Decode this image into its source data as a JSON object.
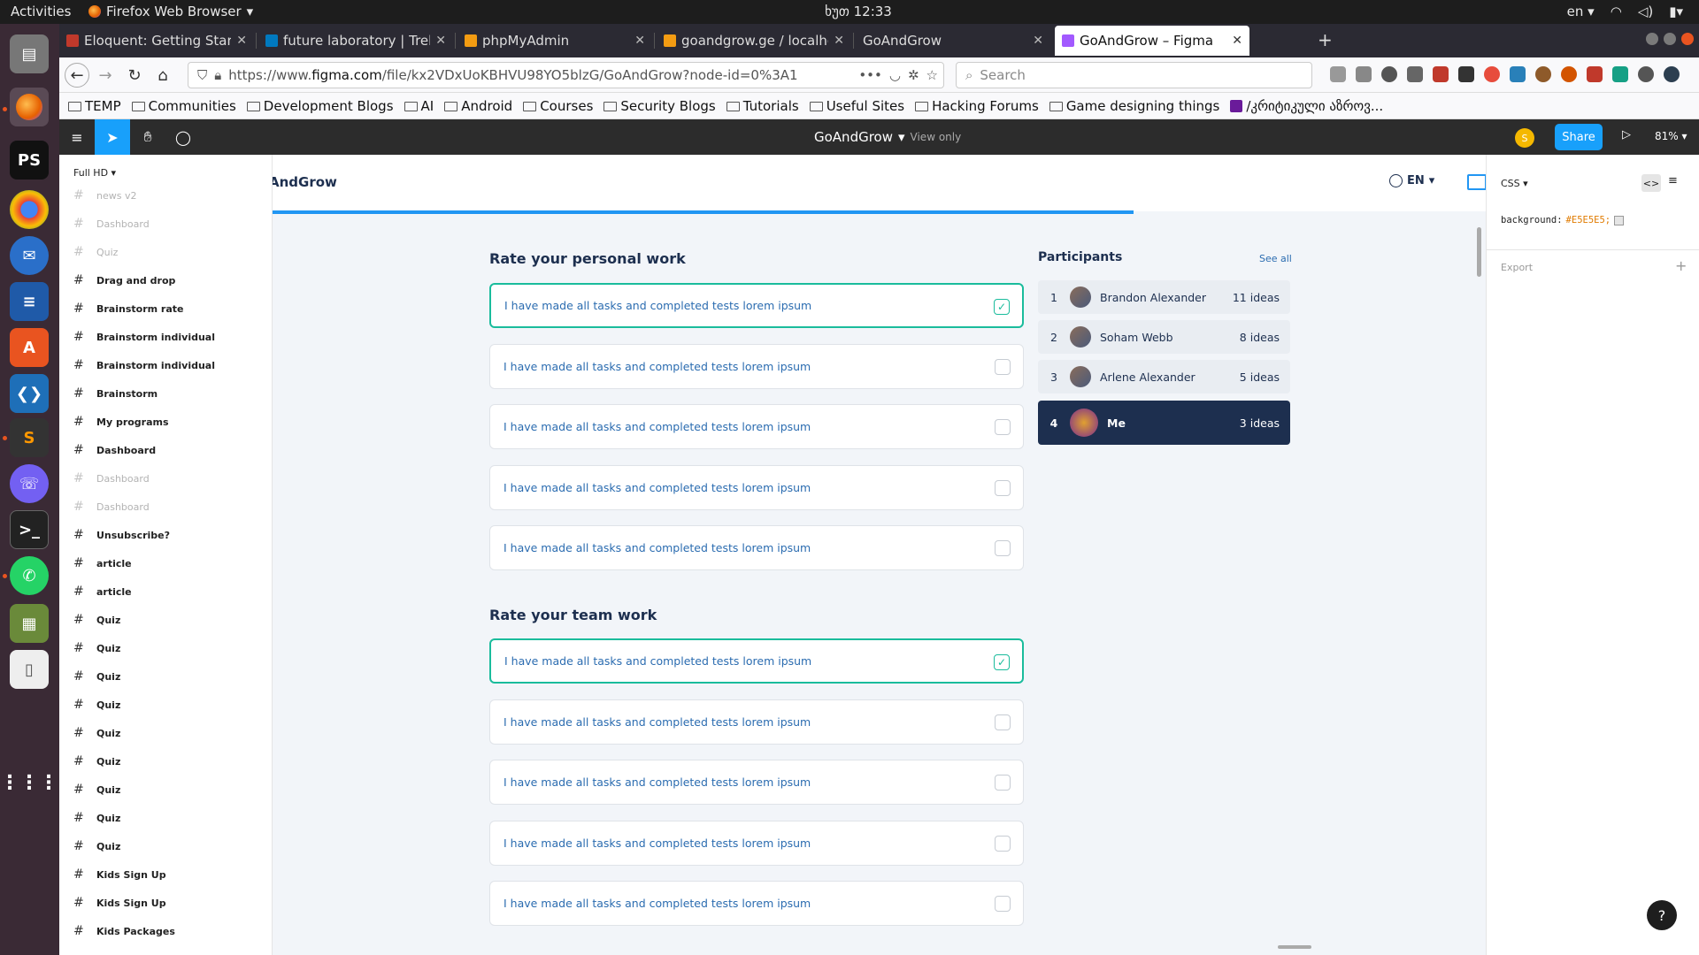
{
  "system": {
    "activities": "Activities",
    "app_name": "Firefox Web Browser",
    "clock": "ხუთ 12:33",
    "lang": "en"
  },
  "tabs": [
    {
      "title": "Eloquent: Getting Starte",
      "fav_color": "#c0392b"
    },
    {
      "title": "future laboratory | Trello",
      "fav_color": "#0079bf"
    },
    {
      "title": "phpMyAdmin",
      "fav_color": "#f39c12"
    },
    {
      "title": "goandgrow.ge / localhos",
      "fav_color": "#f39c12"
    },
    {
      "title": "GoAndGrow",
      "fav_color": ""
    },
    {
      "title": "GoAndGrow – Figma",
      "fav_color": "#a259ff"
    }
  ],
  "navbar": {
    "url_prefix": "https://www.",
    "url_host": "figma.com",
    "url_path": "/file/kx2VDxUoKBHVU98YO5blzG/GoAndGrow?node-id=0%3A1",
    "url_menu": "•••",
    "search_placeholder": "Search"
  },
  "bookmarks": [
    "TEMP",
    "Communities",
    "Development Blogs",
    "AI",
    "Android",
    "Courses",
    "Security Blogs",
    "Tutorials",
    "Useful Sites",
    "Hacking Forums",
    "Game designing things",
    "/კრიტიკული აზროვ..."
  ],
  "figma": {
    "file_title": "GoAndGrow",
    "view_mode": "View only",
    "user_initial": "S",
    "share_label": "Share",
    "zoom": "81%"
  },
  "layers": {
    "page_name": "Full HD",
    "items": [
      {
        "label": "news v2",
        "dim": true
      },
      {
        "label": "Dashboard",
        "dim": true
      },
      {
        "label": "Quiz",
        "dim": true
      },
      {
        "label": "Drag and drop",
        "dim": false
      },
      {
        "label": "Brainstorm rate",
        "dim": false
      },
      {
        "label": "Brainstorm individual",
        "dim": false
      },
      {
        "label": "Brainstorm individual",
        "dim": false
      },
      {
        "label": "Brainstorm",
        "dim": false
      },
      {
        "label": "My programs",
        "dim": false
      },
      {
        "label": "Dashboard",
        "dim": false
      },
      {
        "label": "Dashboard",
        "dim": true
      },
      {
        "label": "Dashboard",
        "dim": true
      },
      {
        "label": "Unsubscribe?",
        "dim": false
      },
      {
        "label": "article",
        "dim": false
      },
      {
        "label": "article",
        "dim": false
      },
      {
        "label": "Quiz",
        "dim": false
      },
      {
        "label": "Quiz",
        "dim": false
      },
      {
        "label": "Quiz",
        "dim": false
      },
      {
        "label": "Quiz",
        "dim": false
      },
      {
        "label": "Quiz",
        "dim": false
      },
      {
        "label": "Quiz",
        "dim": false
      },
      {
        "label": "Quiz",
        "dim": false
      },
      {
        "label": "Quiz",
        "dim": false
      },
      {
        "label": "Quiz",
        "dim": false
      },
      {
        "label": "Kids Sign Up",
        "dim": false
      },
      {
        "label": "Kids Sign Up",
        "dim": false
      },
      {
        "label": "Kids Packages",
        "dim": false
      }
    ]
  },
  "design": {
    "brand": "AndGrow",
    "language": "EN",
    "progress_fraction": 0.71,
    "personal": {
      "title": "Rate your personal work",
      "items": [
        {
          "text": "I have made all tasks and completed tests lorem ipsum",
          "checked": true
        },
        {
          "text": "I have made all tasks and completed tests lorem ipsum",
          "checked": false
        },
        {
          "text": "I have made all tasks and completed tests lorem ipsum",
          "checked": false
        },
        {
          "text": "I have made all tasks and completed tests lorem ipsum",
          "checked": false
        },
        {
          "text": "I have made all tasks and completed tests lorem ipsum",
          "checked": false
        }
      ]
    },
    "team": {
      "title": "Rate your team work",
      "items": [
        {
          "text": "I have made all tasks and completed tests lorem ipsum",
          "checked": true
        },
        {
          "text": "I have made all tasks and completed tests lorem ipsum",
          "checked": false
        },
        {
          "text": "I have made all tasks and completed tests lorem ipsum",
          "checked": false
        },
        {
          "text": "I have made all tasks and completed tests lorem ipsum",
          "checked": false
        },
        {
          "text": "I have made all tasks and completed tests lorem ipsum",
          "checked": false
        }
      ]
    },
    "participants": {
      "title": "Participants",
      "see_all": "See all",
      "rows": [
        {
          "rank": "1",
          "name": "Brandon Alexander",
          "ideas": "11 ideas",
          "me": false
        },
        {
          "rank": "2",
          "name": "Soham Webb",
          "ideas": "8 ideas",
          "me": false
        },
        {
          "rank": "3",
          "name": "Arlene Alexander",
          "ideas": "5 ideas",
          "me": false
        },
        {
          "rank": "4",
          "name": "Me",
          "ideas": "3 ideas",
          "me": true
        }
      ]
    }
  },
  "inspect": {
    "mode": "CSS",
    "code_property": "background:",
    "code_value": "#E5E5E5;",
    "export_label": "Export",
    "help": "?"
  },
  "colors": {
    "accent": "#18a0fb",
    "teal_check": "#1abc9c",
    "navy": "#1d2f4f",
    "canvas_bg": "#f2f5f9"
  }
}
